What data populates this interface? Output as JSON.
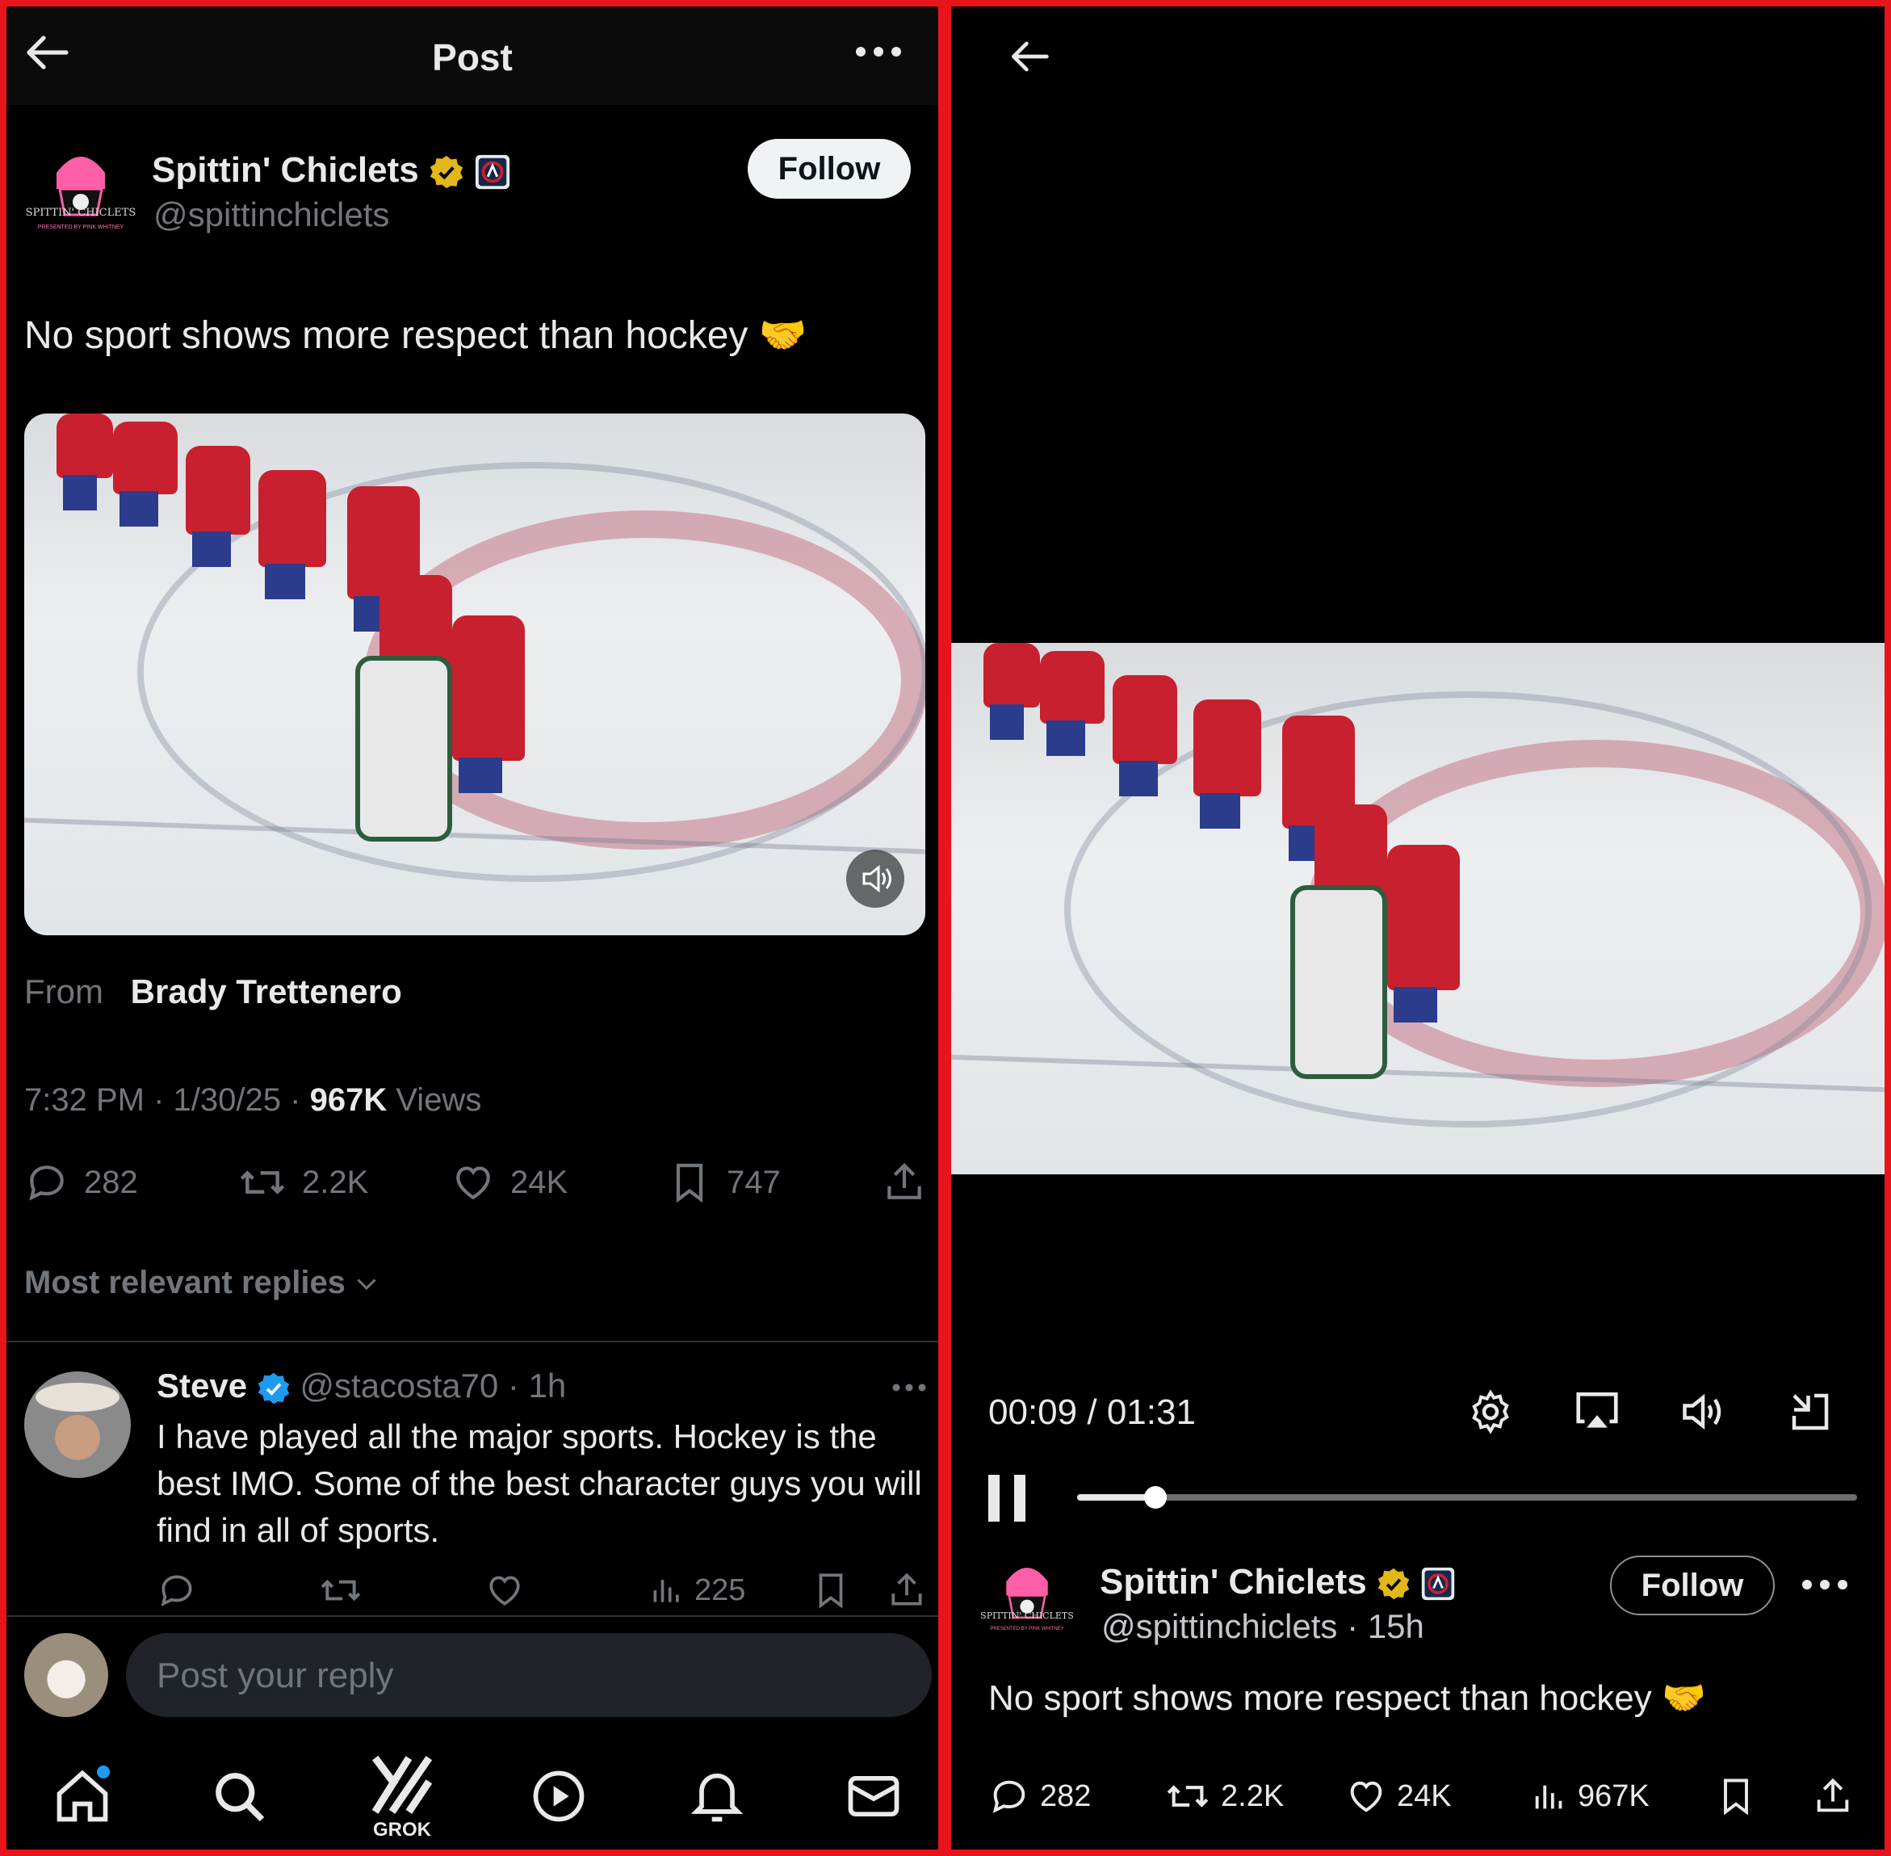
{
  "left": {
    "header": {
      "title": "Post"
    },
    "author": {
      "name": "Spittin' Chiclets",
      "handle": "@spittinchiclets",
      "avatar_label_top": "SPITTIN' CHICLETS",
      "avatar_label_bottom": "PRESENTED BY PINK WHITNEY"
    },
    "follow_label": "Follow",
    "post_text": "No sport shows more respect than hockey 🤝",
    "from_label": "From",
    "from_name": "Brady Trettenero",
    "meta": {
      "time": "7:32 PM",
      "sep1": "·",
      "date": "1/30/25",
      "sep2": "·",
      "views_count": "967K",
      "views_label": "Views"
    },
    "actions": {
      "replies": "282",
      "reposts": "2.2K",
      "likes": "24K",
      "bookmarks": "747"
    },
    "replies_sort": "Most relevant replies",
    "reply": {
      "name": "Steve",
      "handle": "@stacosta70",
      "sep": "·",
      "time": "1h",
      "text": "I have played all the major sports. Hockey is the best IMO. Some of the best character guys you will find in all of sports.",
      "views": "225"
    },
    "composer": {
      "placeholder": "Post your reply"
    },
    "nav": {
      "grok_label": "GROK"
    }
  },
  "right": {
    "player": {
      "current": "00:09",
      "sep": "/",
      "total": "01:31",
      "progress": 0.1
    },
    "author": {
      "name": "Spittin' Chiclets",
      "handle": "@spittinchiclets",
      "sep": "·",
      "time": "15h",
      "avatar_label_top": "SPITTIN' CHICLETS",
      "avatar_label_bottom": "PRESENTED BY PINK WHITNEY"
    },
    "follow_label": "Follow",
    "post_text": "No sport shows more respect than hockey 🤝",
    "actions": {
      "replies": "282",
      "reposts": "2.2K",
      "likes": "24K",
      "views": "967K"
    }
  },
  "colors": {
    "border": "#e8141c",
    "background": "#000000",
    "muted": "#71767b",
    "verified_gold": "#e2b719",
    "verified_blue": "#1d9bf0",
    "notification_dot": "#1d9bf0",
    "jersey_red": "#c8202e"
  },
  "icons": [
    "back-arrow-icon",
    "more-icon",
    "gold-verified-icon",
    "affiliate-badge-icon",
    "blue-verified-icon",
    "volume-icon",
    "reply-icon",
    "repost-icon",
    "like-icon",
    "bookmark-icon",
    "share-icon",
    "views-icon",
    "chevron-down-icon",
    "home-icon",
    "search-icon",
    "grok-icon",
    "play-icon",
    "bell-icon",
    "mail-icon",
    "gear-icon",
    "airplay-icon",
    "exit-fullscreen-icon",
    "pause-icon"
  ]
}
